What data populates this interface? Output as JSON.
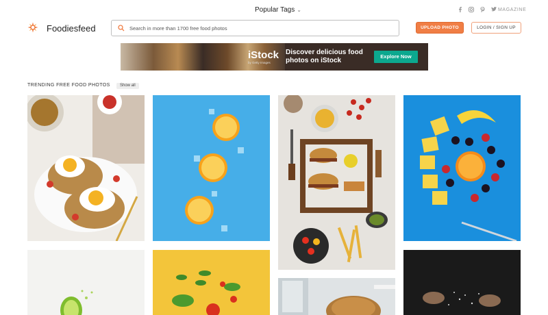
{
  "topbar": {
    "popular_tags": "Popular Tags",
    "magazine": "MAGAZINE",
    "social": [
      "facebook-icon",
      "instagram-icon",
      "pinterest-icon",
      "twitter-icon"
    ]
  },
  "header": {
    "brand": "Foodiesfeed",
    "search_placeholder": "Search in more than 1700 free food photos",
    "upload_label": "UPLOAD PHOTO",
    "login_label": "LOGIN / SIGN UP"
  },
  "banner": {
    "brand": "iStock",
    "brand_sub": "by Getty Images",
    "tagline": "Discover delicious food photos on iStock",
    "cta": "Explore Now"
  },
  "section": {
    "title": "TRENDING FREE FOOD PHOTOS",
    "show_all": "Show all"
  },
  "colors": {
    "accent": "#f07e45",
    "cta_green": "#0ca88f"
  },
  "photos": [
    {
      "subject": "eggs-on-toast"
    },
    {
      "subject": "oranges-on-blue"
    },
    {
      "subject": "burger-fries-board"
    },
    {
      "subject": "fruit-circle-blue"
    },
    {
      "subject": "lime-splash"
    },
    {
      "subject": "basil-tomatoes-yellow"
    },
    {
      "subject": "bread-glass"
    },
    {
      "subject": "flour-hands-dark"
    }
  ]
}
